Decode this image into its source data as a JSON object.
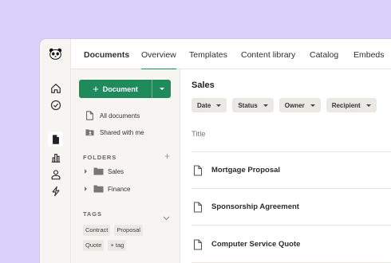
{
  "app": {
    "tabs": [
      {
        "label": "Documents",
        "bold": true
      },
      {
        "label": "Overview",
        "active": true
      },
      {
        "label": "Templates"
      },
      {
        "label": "Content library"
      },
      {
        "label": "Catalog"
      },
      {
        "label": "Embeds"
      }
    ]
  },
  "rail": {
    "icons": [
      "panda-logo",
      "home-icon",
      "check-circle-icon",
      "document-icon",
      "bar-chart-icon",
      "person-icon",
      "lightning-icon"
    ],
    "active": "document-icon"
  },
  "sidebar": {
    "new_button_label": "Document",
    "links": [
      {
        "label": "All documents",
        "icon": "document-outline-icon"
      },
      {
        "label": "Shared with me",
        "icon": "shared-folder-icon"
      }
    ],
    "folders_title": "FOLDERS",
    "folders": [
      "Sales",
      "Finance"
    ],
    "tags_title": "TAGS",
    "tags": [
      "Contract",
      "Proposal",
      "Quote"
    ],
    "add_tag_label": "+ tag"
  },
  "main": {
    "title": "Sales",
    "filters": [
      "Date",
      "Status",
      "Owner",
      "Recipient"
    ],
    "column_title": "Title",
    "documents": [
      "Mortgage Proposal",
      "Sponsorship Agreement",
      "Computer Service Quote"
    ]
  },
  "colors": {
    "accent": "#1f8a5b",
    "background": "#d9d1fb",
    "sidebar": "#f7f5f2"
  }
}
